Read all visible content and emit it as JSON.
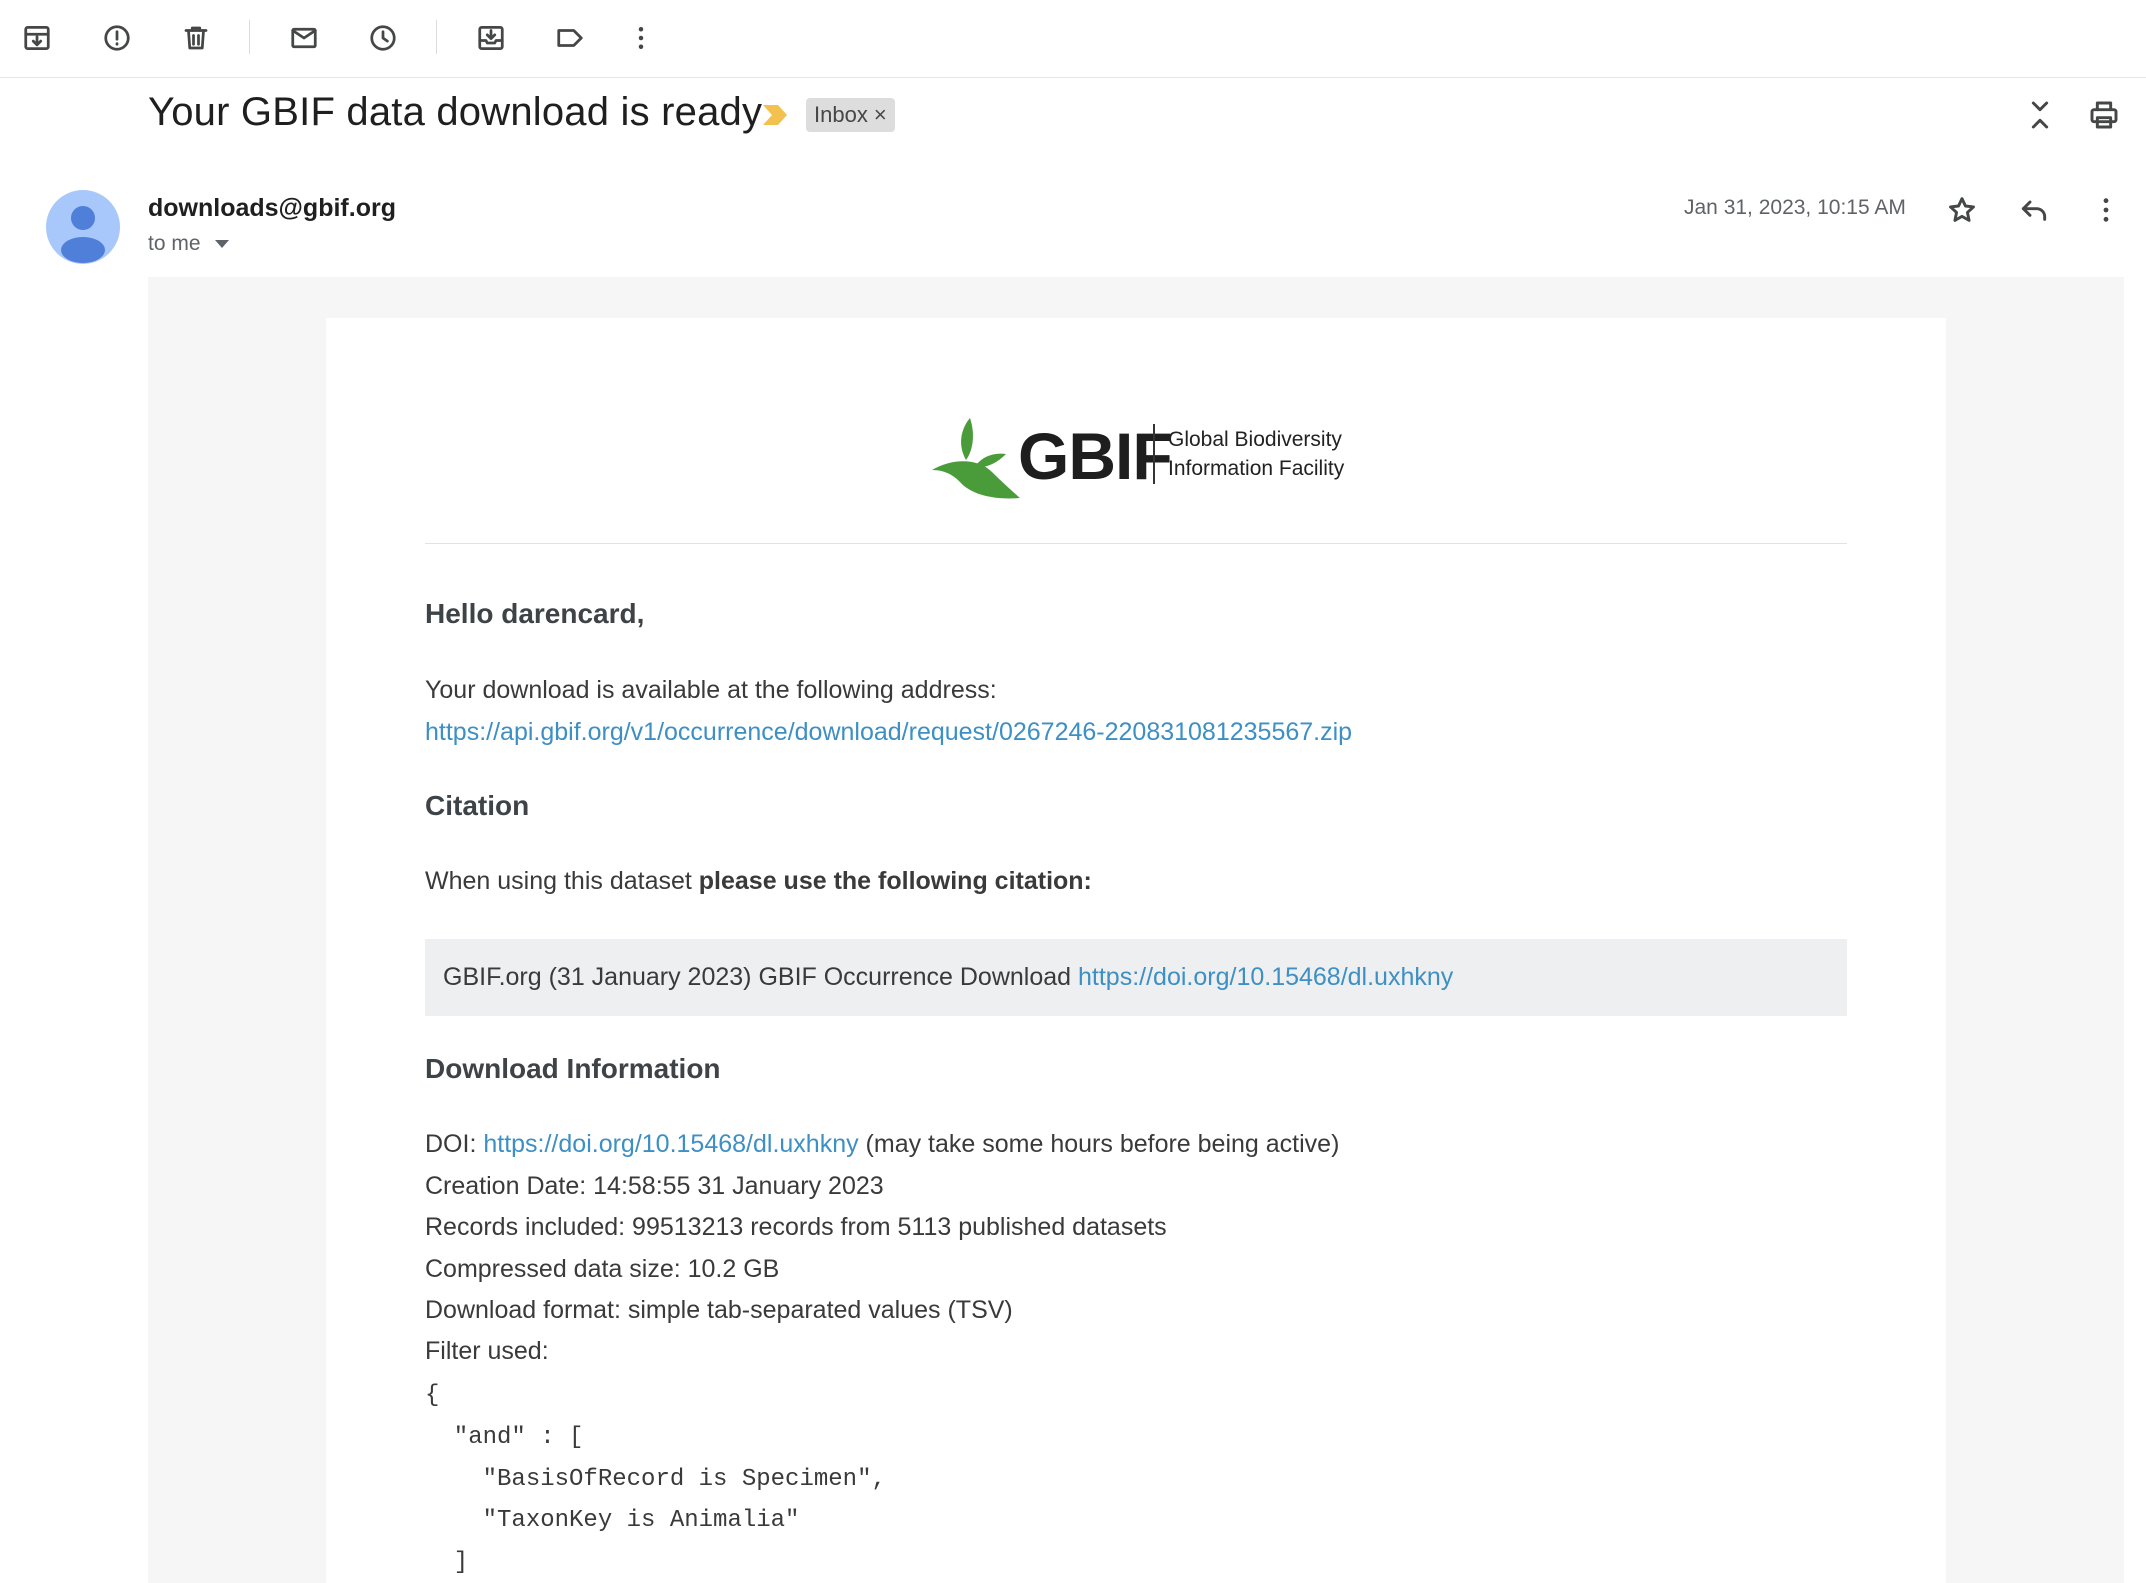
{
  "toolbar": {
    "icons": [
      "archive-icon",
      "report-spam-icon",
      "delete-icon",
      "mark-unread-icon",
      "snooze-icon",
      "move-to-icon",
      "label-icon",
      "more-vert-icon"
    ]
  },
  "subject": {
    "title": "Your GBIF data download is ready",
    "label": "Inbox",
    "label_remove": "×"
  },
  "sender": {
    "email": "downloads@gbif.org",
    "recipient": "to me",
    "date": "Jan 31, 2023, 10:15 AM"
  },
  "body": {
    "logo": {
      "wordmark": "GBIF",
      "line1": "Global Biodiversity",
      "line2": "Information Facility"
    },
    "greeting": "Hello darencard,",
    "available_text": "Your download is available at the following address:",
    "download_url": "https://api.gbif.org/v1/occurrence/download/request/0267246-220831081235567.zip",
    "citation_heading": "Citation",
    "citation_intro": "When using this dataset ",
    "citation_intro_bold": "please use the following citation:",
    "citation_text": "GBIF.org (31 January 2023) GBIF Occurrence Download ",
    "citation_doi": "https://doi.org/10.15468/dl.uxhkny",
    "info_heading": "Download Information",
    "doi_label": "DOI: ",
    "doi_link": "https://doi.org/10.15468/dl.uxhkny",
    "doi_note": " (may take some hours before being active)",
    "creation_date": "Creation Date: 14:58:55 31 January 2023",
    "records": "Records included: 99513213 records from 5113 published datasets",
    "size": "Compressed data size: 10.2 GB",
    "format": "Download format: simple tab-separated values (TSV)",
    "filter_label": "Filter used:",
    "filter_lines": [
      "{",
      "  \"and\" : [",
      "    \"BasisOfRecord is Specimen\",",
      "    \"TaxonKey is Animalia\"",
      "  ]"
    ]
  },
  "colors": {
    "link": "#3d8fc4",
    "importance": "#f2c14e",
    "logo_leaf": "#4a9c3a",
    "avatar_bg": "#a8c7fa",
    "avatar_fg": "#4f7fd9"
  }
}
